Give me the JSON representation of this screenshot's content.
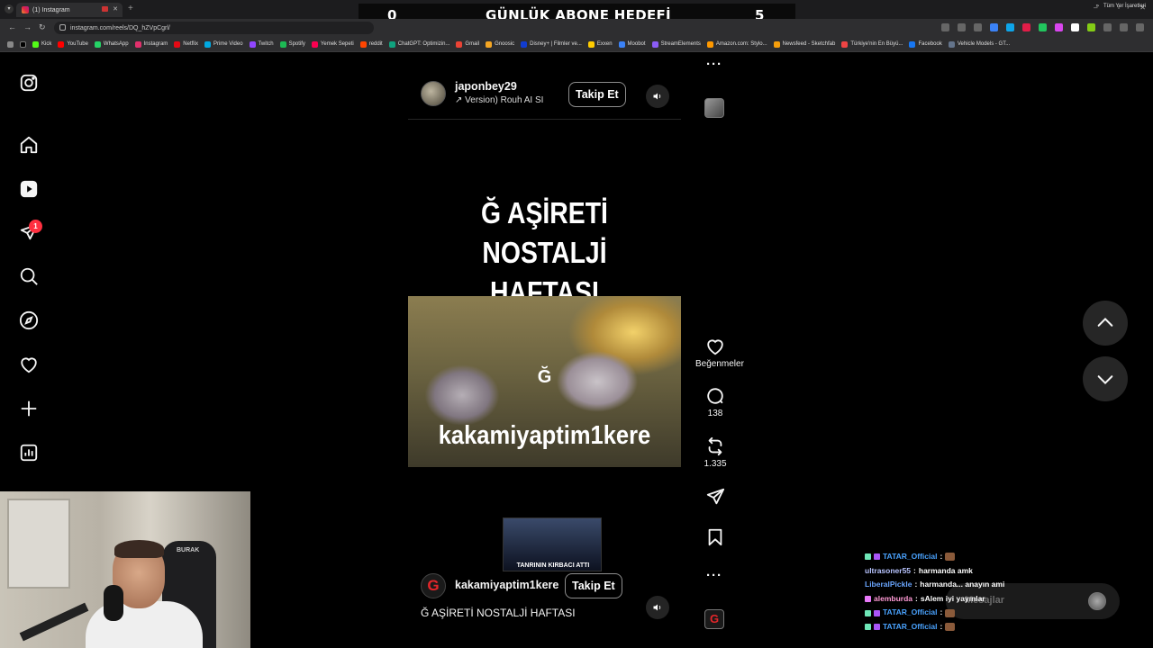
{
  "browser": {
    "tab_title": "(1) Instagram",
    "url": "instagram.com/reels/DQ_hZVpCgrl/",
    "bookmarks": [
      "Kick",
      "YouTube",
      "WhatsApp",
      "Instagram",
      "Netflix",
      "Prime Video",
      "Twitch",
      "Spotify",
      "Yemek Sepeti",
      "reddit",
      "ChatGPT: Optimizin...",
      "Gmail",
      "Gnoosic",
      "Disney+ | Filmler ve...",
      "Exxen",
      "Moobot",
      "StreamElements",
      "Amazon.com: Stylo...",
      "Newsfeed - Sketchfab",
      "Türkiye'nin En Büyü...",
      "Facebook",
      "Vehicle Models - GT..."
    ],
    "bookmarks_more": "»",
    "all_bookmarks": "Tüm Yer İşaretleri"
  },
  "stream_overlay": {
    "left_count": "0",
    "title": "GÜNLÜK ABONE HEDEFİ",
    "right_count": "5"
  },
  "sidebar": {
    "notification_count": "1"
  },
  "previous_reel": {
    "username": "japonbey29",
    "audio": "↗  Version)  Rouh AI SI",
    "follow_label": "Takip Et"
  },
  "reel": {
    "title_line1": "Ğ AŞİRETİ",
    "title_line2": "NOSTALJİ HAFTASI",
    "image_letter": "Ğ",
    "image_caption": "kakamiyaptim1kere",
    "inset_caption": "TANRININ KIRBACI ATTI",
    "username": "kakamiyaptim1kere",
    "follow_label": "Takip Et",
    "caption": "Ğ AŞİRETİ NOSTALJİ HAFTASI",
    "avatar_letter": "G"
  },
  "actions": {
    "likes_label": "Beğenmeler",
    "comments_count": "138",
    "reposts_count": "1.335"
  },
  "webcam": {
    "chair_brand": "BURAK"
  },
  "chat": {
    "messages": [
      {
        "user": "TATAR_Official",
        "text": "",
        "color": "#4aa3ff"
      },
      {
        "user": "ultrasoner55",
        "text": "harmanda amk",
        "color": "#b8c4ff"
      },
      {
        "user": "LiberalPickle",
        "text": "harmanda... anayın ami",
        "color": "#6aa6ff"
      },
      {
        "user": "alemburda",
        "text": "sAlem iyi yayınlar",
        "color": "#ff9ad5"
      },
      {
        "user": "TATAR_Official",
        "text": "",
        "color": "#4aa3ff"
      },
      {
        "user": "TATAR_Official",
        "text": "",
        "color": "#4aa3ff"
      }
    ],
    "dm_label": "Mesajlar"
  },
  "colors": {
    "instagram_red": "#ff3040",
    "background": "#000000",
    "button_border": "#8e8e8e"
  }
}
